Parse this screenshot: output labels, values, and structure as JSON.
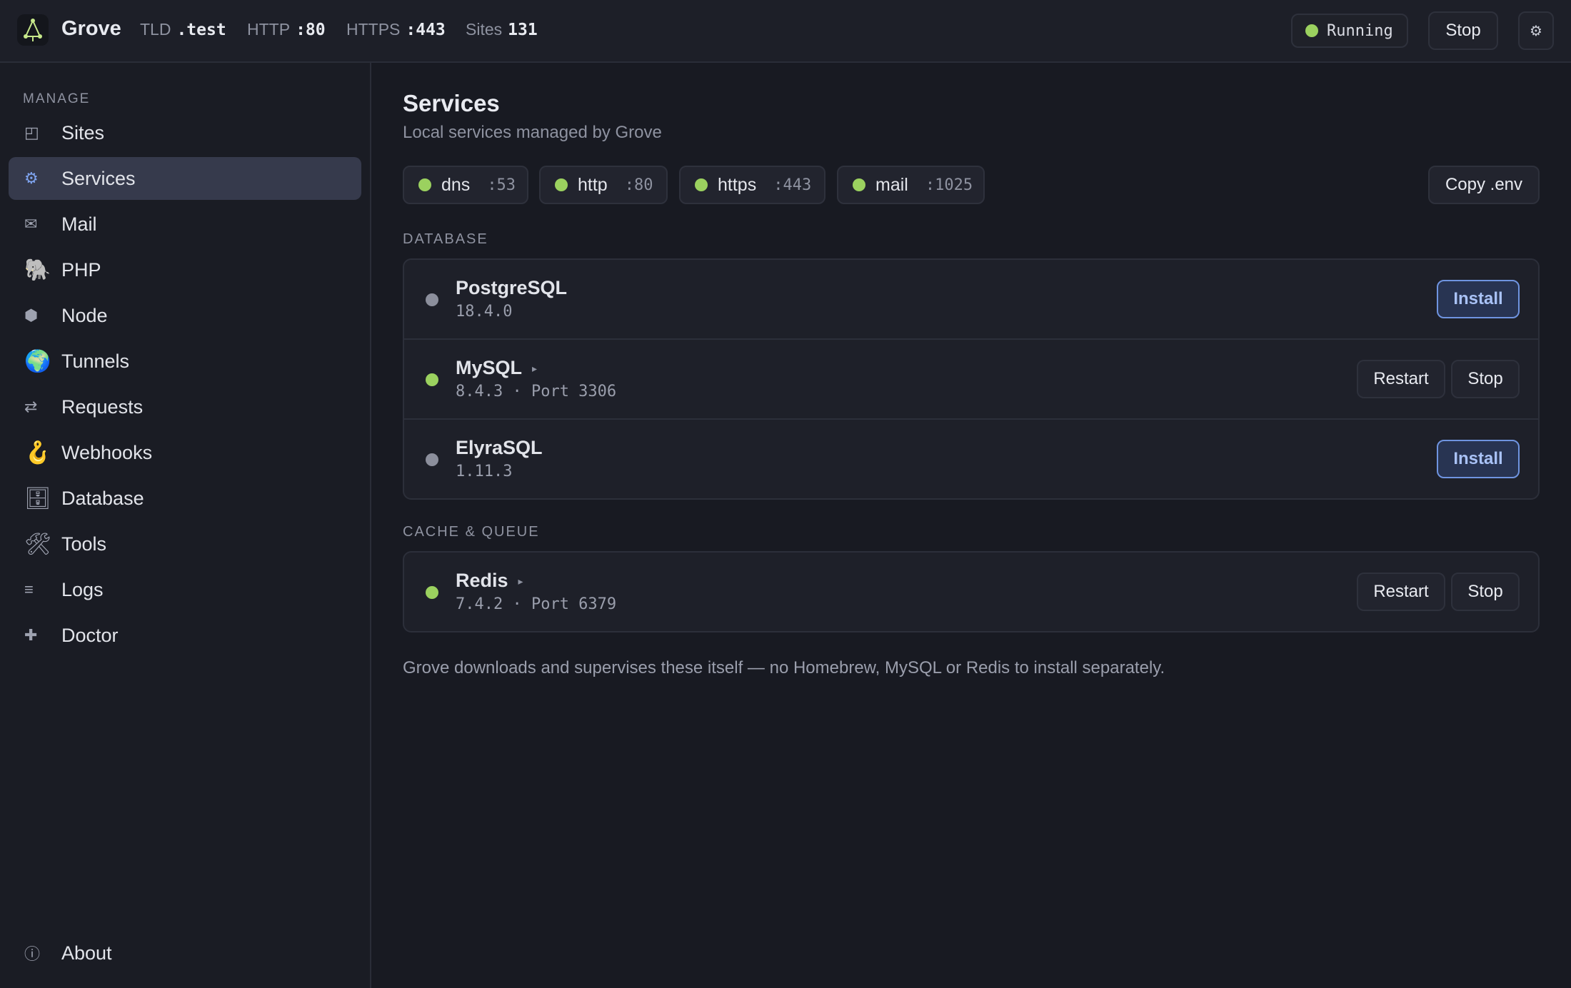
{
  "app": {
    "name": "Grove",
    "stats": [
      {
        "label": "TLD",
        "value": ".test"
      },
      {
        "label": "HTTP",
        "value": ":80"
      },
      {
        "label": "HTTPS",
        "value": ":443"
      },
      {
        "label": "Sites",
        "value": "131"
      }
    ],
    "status": "Running",
    "stop_label": "Stop",
    "settings_icon": "⚙",
    "colors": {
      "accent": "#6f94e0",
      "running": "#9bd15f",
      "stopped": "#8c8f9c"
    }
  },
  "sidebar": {
    "section": "MANAGE",
    "items": [
      {
        "label": "Sites",
        "icon": "◰",
        "icon_name": "sites-icon"
      },
      {
        "label": "Services",
        "icon": "⚙",
        "icon_name": "gear-icon",
        "active": true
      },
      {
        "label": "Mail",
        "icon": "✉",
        "icon_name": "mail-icon"
      },
      {
        "label": "PHP",
        "icon": "🐘",
        "icon_name": "elephant-icon"
      },
      {
        "label": "Node",
        "icon": "⬢",
        "icon_name": "hexagon-icon"
      },
      {
        "label": "Tunnels",
        "icon": "🌍",
        "icon_name": "globe-icon"
      },
      {
        "label": "Requests",
        "icon": "⇄",
        "icon_name": "arrows-icon"
      },
      {
        "label": "Webhooks",
        "icon": "🪝",
        "icon_name": "hook-icon"
      },
      {
        "label": "Database",
        "icon": "🗄",
        "icon_name": "cabinet-icon"
      },
      {
        "label": "Tools",
        "icon": "🛠",
        "icon_name": "tools-icon"
      },
      {
        "label": "Logs",
        "icon": "≡",
        "icon_name": "lines-icon"
      },
      {
        "label": "Doctor",
        "icon": "✚",
        "icon_name": "plus-icon"
      }
    ],
    "about": {
      "label": "About",
      "icon": "ⓘ",
      "icon_name": "info-icon"
    }
  },
  "main": {
    "title": "Services",
    "subtitle": "Local services managed by Grove",
    "chips": [
      {
        "name": "dns",
        "port": ":53"
      },
      {
        "name": "http",
        "port": ":80"
      },
      {
        "name": "https",
        "port": ":443"
      },
      {
        "name": "mail",
        "port": ":1025"
      }
    ],
    "copy_env": "Copy .env",
    "groups": [
      {
        "label": "DATABASE",
        "services": [
          {
            "name": "PostgreSQL",
            "meta": "18.4.0",
            "running": false,
            "caret": "",
            "actions": [
              "Install"
            ]
          },
          {
            "name": "MySQL",
            "meta": "8.4.3 · Port 3306",
            "running": true,
            "caret": "▸",
            "actions": [
              "Restart",
              "Stop"
            ]
          },
          {
            "name": "ElyraSQL",
            "meta": "1.11.3",
            "running": false,
            "caret": "",
            "actions": [
              "Install"
            ]
          }
        ]
      },
      {
        "label": "CACHE & QUEUE",
        "services": [
          {
            "name": "Redis",
            "meta": "7.4.2 · Port 6379",
            "running": true,
            "caret": "▸",
            "actions": [
              "Restart",
              "Stop"
            ]
          }
        ]
      }
    ],
    "footer": "Grove downloads and supervises these itself — no Homebrew, MySQL or Redis to install separately."
  }
}
